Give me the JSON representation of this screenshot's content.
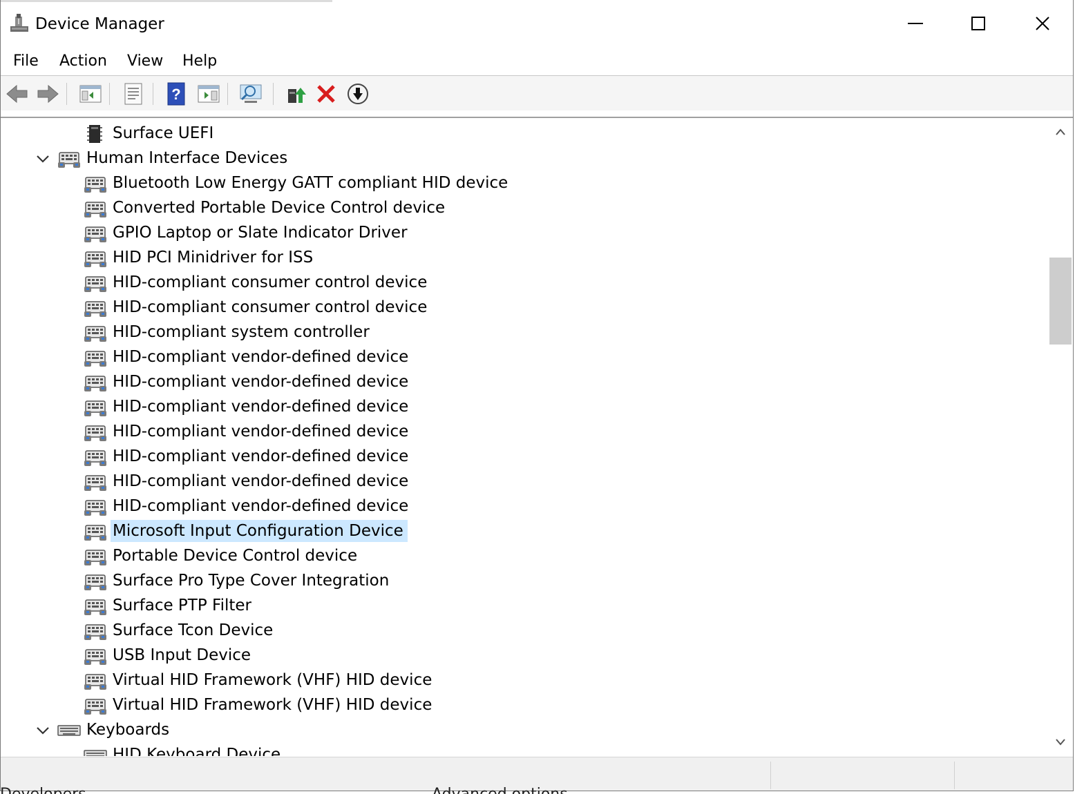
{
  "window": {
    "title": "Device Manager"
  },
  "menu": [
    "File",
    "Action",
    "View",
    "Help"
  ],
  "toolbar": [
    {
      "icon": "back-arrow-icon"
    },
    {
      "icon": "forward-arrow-icon"
    },
    {
      "icon": "show-hide-console-tree-icon"
    },
    {
      "icon": "properties-icon"
    },
    {
      "icon": "help-icon"
    },
    {
      "icon": "show-action-pane-icon"
    },
    {
      "icon": "scan-hardware-changes-icon"
    },
    {
      "icon": "update-driver-icon"
    },
    {
      "icon": "uninstall-device-icon"
    },
    {
      "icon": "disable-device-icon"
    }
  ],
  "tree": [
    {
      "label": "Surface UEFI",
      "level": 1,
      "icon": "firmware-chip-icon"
    },
    {
      "label": "Human Interface Devices",
      "level": 0,
      "icon": "hid-icon",
      "expanded": true
    },
    {
      "label": "Bluetooth Low Energy GATT compliant HID device",
      "level": 1,
      "icon": "hid-icon"
    },
    {
      "label": "Converted Portable Device Control device",
      "level": 1,
      "icon": "hid-icon"
    },
    {
      "label": "GPIO Laptop or Slate Indicator Driver",
      "level": 1,
      "icon": "hid-icon"
    },
    {
      "label": "HID PCI Minidriver for ISS",
      "level": 1,
      "icon": "hid-icon"
    },
    {
      "label": "HID-compliant consumer control device",
      "level": 1,
      "icon": "hid-icon"
    },
    {
      "label": "HID-compliant consumer control device",
      "level": 1,
      "icon": "hid-icon"
    },
    {
      "label": "HID-compliant system controller",
      "level": 1,
      "icon": "hid-icon"
    },
    {
      "label": "HID-compliant vendor-defined device",
      "level": 1,
      "icon": "hid-icon"
    },
    {
      "label": "HID-compliant vendor-defined device",
      "level": 1,
      "icon": "hid-icon"
    },
    {
      "label": "HID-compliant vendor-defined device",
      "level": 1,
      "icon": "hid-icon"
    },
    {
      "label": "HID-compliant vendor-defined device",
      "level": 1,
      "icon": "hid-icon"
    },
    {
      "label": "HID-compliant vendor-defined device",
      "level": 1,
      "icon": "hid-icon"
    },
    {
      "label": "HID-compliant vendor-defined device",
      "level": 1,
      "icon": "hid-icon"
    },
    {
      "label": "HID-compliant vendor-defined device",
      "level": 1,
      "icon": "hid-icon"
    },
    {
      "label": "Microsoft Input Configuration Device",
      "level": 1,
      "icon": "hid-icon",
      "selected": true
    },
    {
      "label": "Portable Device Control device",
      "level": 1,
      "icon": "hid-icon"
    },
    {
      "label": "Surface Pro Type Cover Integration",
      "level": 1,
      "icon": "hid-icon"
    },
    {
      "label": "Surface PTP Filter",
      "level": 1,
      "icon": "hid-icon"
    },
    {
      "label": "Surface Tcon Device",
      "level": 1,
      "icon": "hid-icon"
    },
    {
      "label": "USB Input Device",
      "level": 1,
      "icon": "hid-icon"
    },
    {
      "label": "Virtual HID Framework (VHF) HID device",
      "level": 1,
      "icon": "hid-icon"
    },
    {
      "label": "Virtual HID Framework (VHF) HID device",
      "level": 1,
      "icon": "hid-icon"
    },
    {
      "label": "Keyboards",
      "level": 0,
      "icon": "keyboard-icon",
      "expanded": true
    },
    {
      "label": "HID Keyboard Device",
      "level": 1,
      "icon": "keyboard-icon"
    }
  ],
  "background_peek": [
    "Developers",
    "Advanced options"
  ],
  "colors": {
    "selection": "#cce8ff",
    "toolbar_bg": "#f5f5f5",
    "status_bg": "#f0f0f0"
  }
}
